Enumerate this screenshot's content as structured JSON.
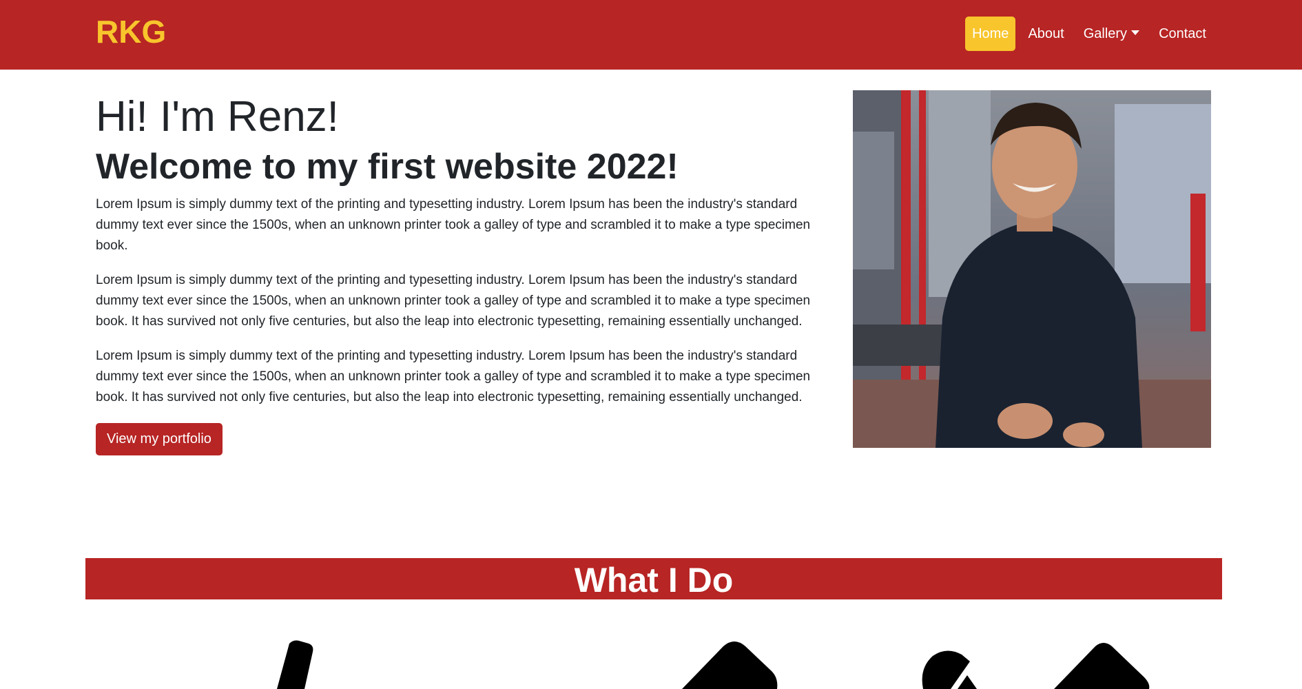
{
  "nav": {
    "brand": "RKG",
    "links": [
      {
        "label": "Home",
        "active": true
      },
      {
        "label": "About",
        "active": false
      },
      {
        "label": "Gallery",
        "active": false,
        "dropdown": true
      },
      {
        "label": "Contact",
        "active": false
      }
    ]
  },
  "hero": {
    "greeting": "Hi! I'm Renz!",
    "welcome": "Welcome to my first website 2022!",
    "paragraphs": [
      "Lorem Ipsum is simply dummy text of the printing and typesetting industry. Lorem Ipsum has been the industry's standard dummy text ever since the 1500s, when an unknown printer took a galley of type and scrambled it to make a type specimen book.",
      "Lorem Ipsum is simply dummy text of the printing and typesetting industry. Lorem Ipsum has been the industry's standard dummy text ever since the 1500s, when an unknown printer took a galley of type and scrambled it to make a type specimen book. It has survived not only five centuries, but also the leap into electronic typesetting, remaining essentially unchanged.",
      "Lorem Ipsum is simply dummy text of the printing and typesetting industry. Lorem Ipsum has been the industry's standard dummy text ever since the 1500s, when an unknown printer took a galley of type and scrambled it to make a type specimen book. It has survived not only five centuries, but also the leap into electronic typesetting, remaining essentially unchanged."
    ],
    "button": "View my portfolio"
  },
  "section": {
    "title": "What I Do"
  },
  "services": {
    "icons": [
      "pen-icon",
      "eraser-icon",
      "edit-icon"
    ]
  },
  "colors": {
    "primary_red": "#b72524",
    "accent_yellow": "#f8c52c",
    "text": "#212529"
  }
}
